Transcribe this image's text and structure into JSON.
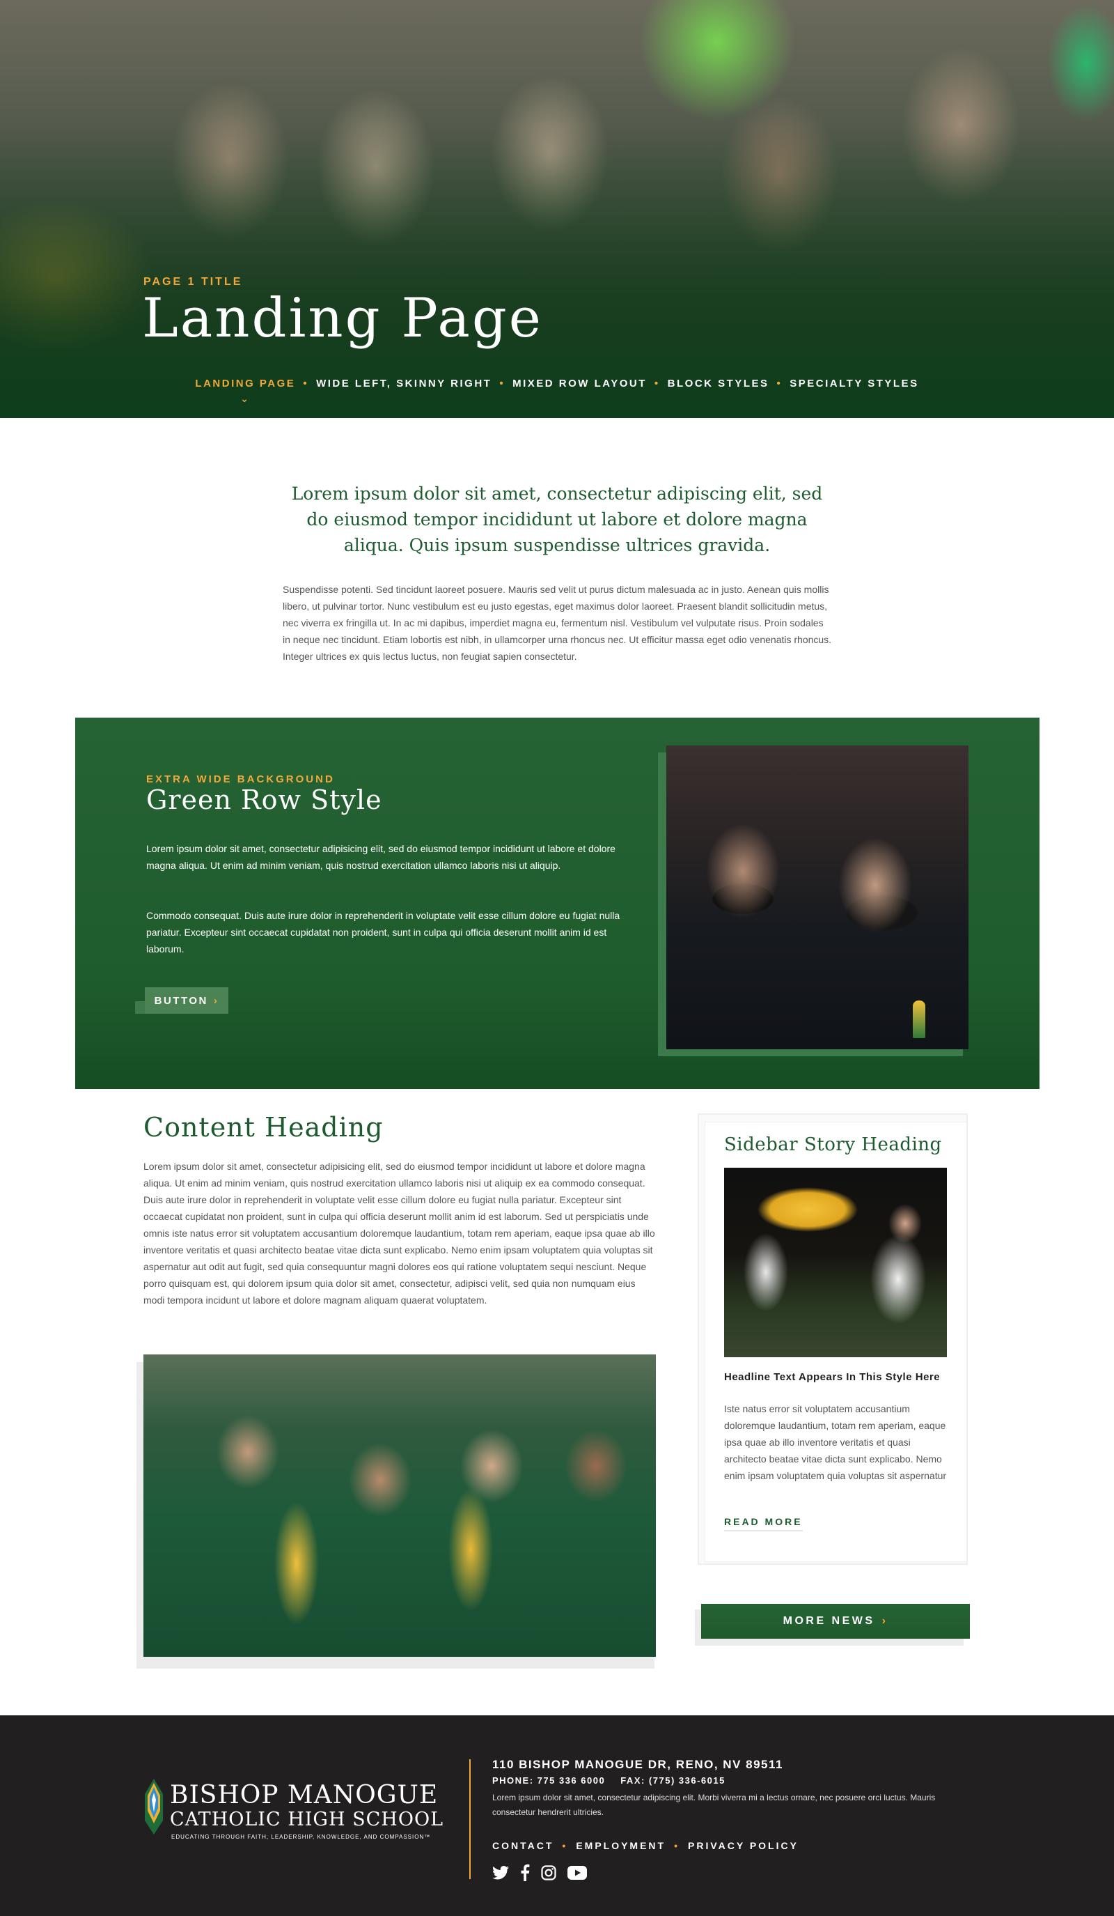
{
  "hero": {
    "eyebrow": "PAGE 1 TITLE",
    "title": "Landing Page",
    "nav": [
      {
        "label": "LANDING PAGE",
        "active": true
      },
      {
        "label": "WIDE LEFT, SKINNY RIGHT",
        "active": false
      },
      {
        "label": "MIXED ROW LAYOUT",
        "active": false
      },
      {
        "label": "BLOCK STYLES",
        "active": false
      },
      {
        "label": "SPECIALTY STYLES",
        "active": false
      }
    ]
  },
  "intro": {
    "lead": "Lorem ipsum dolor sit amet, consectetur adipiscing elit, sed do eiusmod tempor incididunt ut labore et dolore magna aliqua. Quis ipsum suspendisse ultrices gravida.",
    "body": "Suspendisse potenti. Sed tincidunt laoreet posuere. Mauris sed velit ut purus dictum malesuada ac in justo. Aenean quis mollis libero, ut pulvinar tortor. Nunc vestibulum est eu justo egestas, eget maximus dolor laoreet. Praesent blandit sollicitudin metus, nec viverra ex fringilla ut. In ac mi dapibus, imperdiet magna eu, fermentum nisl. Vestibulum vel vulputate risus. Proin sodales in neque nec tincidunt. Etiam lobortis est nibh, in ullamcorper urna rhoncus nec. Ut efficitur massa eget odio venenatis rhoncus. Integer ultrices ex quis lectus luctus, non feugiat sapien consectetur."
  },
  "green_row": {
    "eyebrow": "EXTRA WIDE BACKGROUND",
    "title": "Green Row Style",
    "p1": "Lorem ipsum dolor sit amet, consectetur adipisicing elit, sed do eiusmod tempor incididunt ut labore et dolore magna aliqua. Ut enim ad minim veniam, quis nostrud exercitation ullamco laboris nisi ut aliquip.",
    "p2": "Commodo consequat. Duis aute irure dolor in reprehenderit in voluptate velit esse cillum dolore eu fugiat nulla pariatur. Excepteur sint occaecat cupidatat non proident, sunt in culpa qui officia deserunt mollit anim id est laborum.",
    "button_label": "BUTTON"
  },
  "content": {
    "heading": "Content Heading",
    "body": "Lorem ipsum dolor sit amet, consectetur adipisicing elit, sed do eiusmod tempor incididunt ut labore et dolore magna aliqua. Ut enim ad minim veniam, quis nostrud exercitation ullamco laboris nisi ut aliquip ex ea commodo consequat. Duis aute irure dolor in reprehenderit in voluptate velit esse cillum dolore eu fugiat nulla pariatur. Excepteur sint occaecat cupidatat non proident, sunt in culpa qui officia deserunt mollit anim id est laborum. Sed ut perspiciatis unde omnis iste natus error sit voluptatem accusantium doloremque laudantium, totam rem aperiam, eaque ipsa quae ab illo inventore veritatis et quasi architecto beatae vitae dicta sunt explicabo. Nemo enim ipsam voluptatem quia voluptas sit aspernatur aut odit aut fugit, sed quia consequuntur magni dolores eos qui ratione voluptatem sequi nesciunt. Neque porro quisquam est, qui dolorem ipsum quia dolor sit amet, consectetur, adipisci velit, sed quia non numquam eius modi tempora incidunt ut labore et dolore magnam aliquam quaerat voluptatem."
  },
  "sidebar": {
    "heading": "Sidebar Story Heading",
    "headline": "Headline Text Appears In This Style Here",
    "body": "Iste natus error sit voluptatem accusantium doloremque laudantium, totam rem aperiam, eaque ipsa quae ab illo inventore veritatis et quasi architecto beatae vitae dicta sunt explicabo. Nemo enim ipsam voluptatem quia voluptas sit aspernatur",
    "read_more": "READ MORE",
    "more_news": "MORE NEWS"
  },
  "footer": {
    "name_line1": "BISHOP MANOGUE",
    "name_line2": "CATHOLIC HIGH SCHOOL",
    "tagline": "EDUCATING THROUGH FAITH, LEADERSHIP, KNOWLEDGE, AND COMPASSION™",
    "address": "110 BISHOP MANOGUE DR, RENO, NV 89511",
    "phone": "PHONE: 775 336 6000",
    "fax": "FAX: (775) 336-6015",
    "description": "Lorem ipsum dolor sit amet, consectetur adipiscing elit. Morbi viverra mi a lectus ornare, nec posuere orci luctus. Mauris consectetur hendrerit ultricies.",
    "links": [
      "CONTACT",
      "EMPLOYMENT",
      "PRIVACY POLICY"
    ],
    "social": [
      "twitter-icon",
      "facebook-icon",
      "instagram-icon",
      "youtube-icon"
    ]
  },
  "colors": {
    "brand_green": "#1e5a30",
    "accent_gold": "#f2a83a",
    "footer_bg": "#221f20"
  }
}
